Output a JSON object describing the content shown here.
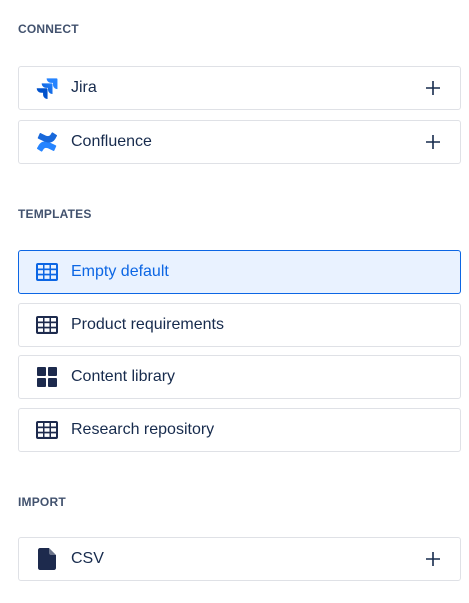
{
  "sections": {
    "connect": {
      "title": "CONNECT",
      "items": [
        {
          "label": "Jira",
          "icon": "jira-logo-icon",
          "action": "plus-icon"
        },
        {
          "label": "Confluence",
          "icon": "confluence-logo-icon",
          "action": "plus-icon"
        }
      ]
    },
    "templates": {
      "title": "TEMPLATES",
      "items": [
        {
          "label": "Empty default",
          "icon": "table-icon",
          "selected": true
        },
        {
          "label": "Product requirements",
          "icon": "table-icon"
        },
        {
          "label": "Content library",
          "icon": "grid-icon"
        },
        {
          "label": "Research repository",
          "icon": "table-icon"
        }
      ]
    },
    "import": {
      "title": "IMPORT",
      "items": [
        {
          "label": "CSV",
          "icon": "file-icon",
          "action": "plus-icon"
        }
      ]
    }
  },
  "colors": {
    "text": "#172b4d",
    "section_title": "#42526e",
    "border": "#dfe1e6",
    "selected_bg": "#e9f2ff",
    "selected_accent": "#0c66e4",
    "icon_dark": "#1d2a4d",
    "brand_blue": "#2684ff"
  }
}
